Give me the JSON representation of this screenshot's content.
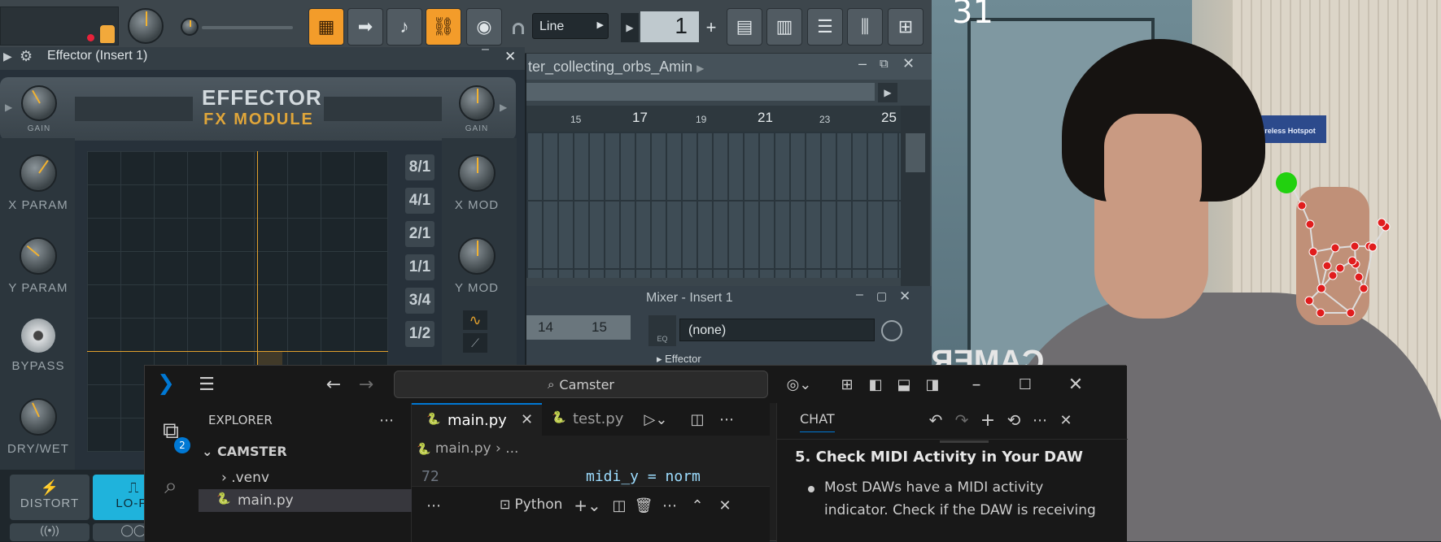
{
  "fl": {
    "snap_mode": "Line",
    "pattern_number": "1",
    "playlist_title": "ter_collecting_orbs_Amin",
    "bar_numbers": [
      "15",
      "17",
      "19",
      "21",
      "23",
      "25"
    ],
    "mixer_title": "Mixer - Insert 1",
    "mixer_tracks": [
      "14",
      "15"
    ],
    "mixer_slot_none": "(none)",
    "mixer_eq_label": "EQ",
    "mixer_effector_label": "Effector"
  },
  "effector": {
    "window_title": "Effector (Insert 1)",
    "title_line1": "EFFECTOR",
    "title_line2": "FX MODULE",
    "gain_left": "GAIN",
    "gain_right": "GAIN",
    "x_param": "X PARAM",
    "y_param": "Y PARAM",
    "bypass": "BYPASS",
    "dry_wet": "DRY/WET",
    "x_mod": "X MOD",
    "y_mod": "Y MOD",
    "ratios": [
      "8/1",
      "4/1",
      "2/1",
      "1/1",
      "3/4",
      "1/2"
    ],
    "modes": [
      "DISTORT",
      "LO-FI"
    ]
  },
  "vscode": {
    "search_text": "Camster",
    "explorer_title": "EXPLORER",
    "folder": "CAMSTER",
    "tree": [
      ".venv",
      "main.py"
    ],
    "explorer_badge": "2",
    "tabs": [
      "main.py",
      "test.py"
    ],
    "breadcrumb": [
      "main.py",
      "..."
    ],
    "code_line_number": "72",
    "code_text": "midi_y = norm",
    "terminal_shell": "Python",
    "chat_title": "CHAT",
    "chat_heading": "5. Check MIDI Activity in Your DAW",
    "chat_bullet_line1": "Most DAWs have a MIDI activity",
    "chat_bullet_line2": "indicator. Check if the DAW is receiving"
  },
  "camera": {
    "counter": "31",
    "wall_sign": "Wireless Hotspot",
    "shirt_text": "CAMER"
  },
  "colors": {
    "fl_orange": "#f39c2a",
    "vscode_blue": "#0078d4",
    "landmark_red": "#e11d1d",
    "landmark_green": "#22d10f"
  }
}
